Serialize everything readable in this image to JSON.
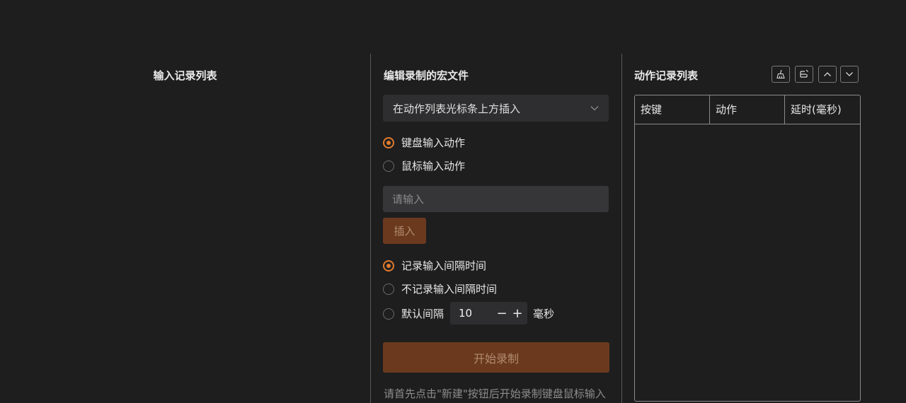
{
  "left": {
    "title": "输入记录列表"
  },
  "editor": {
    "title": "编辑录制的宏文件",
    "insert_position": "在动作列表光标条上方插入",
    "action_type": {
      "keyboard": "键盘输入动作",
      "mouse": "鼠标输入动作",
      "selected": "keyboard"
    },
    "input_placeholder": "请输入",
    "insert_button": "插入",
    "interval": {
      "record": "记录输入间隔时间",
      "no_record": "不记录输入间隔时间",
      "default_label": "默认间隔",
      "default_value": "10",
      "minus": "−",
      "plus": "+",
      "unit": "毫秒",
      "selected": "record"
    },
    "start_button": "开始录制",
    "hint": "请首先点击\"新建\"按钮后开始录制键盘鼠标输入"
  },
  "actions": {
    "title": "动作记录列表",
    "toolbar_icons": [
      "broom-icon",
      "edit-icon",
      "chevron-up-icon",
      "chevron-down-icon"
    ],
    "columns": [
      "按键",
      "动作",
      "延时(毫秒)"
    ],
    "rows": []
  },
  "colors": {
    "background": "#1e1e1f",
    "accent": "#e07b2e",
    "button_disabled_bg": "#6b3a1e",
    "divider": "#5a5a5a"
  }
}
